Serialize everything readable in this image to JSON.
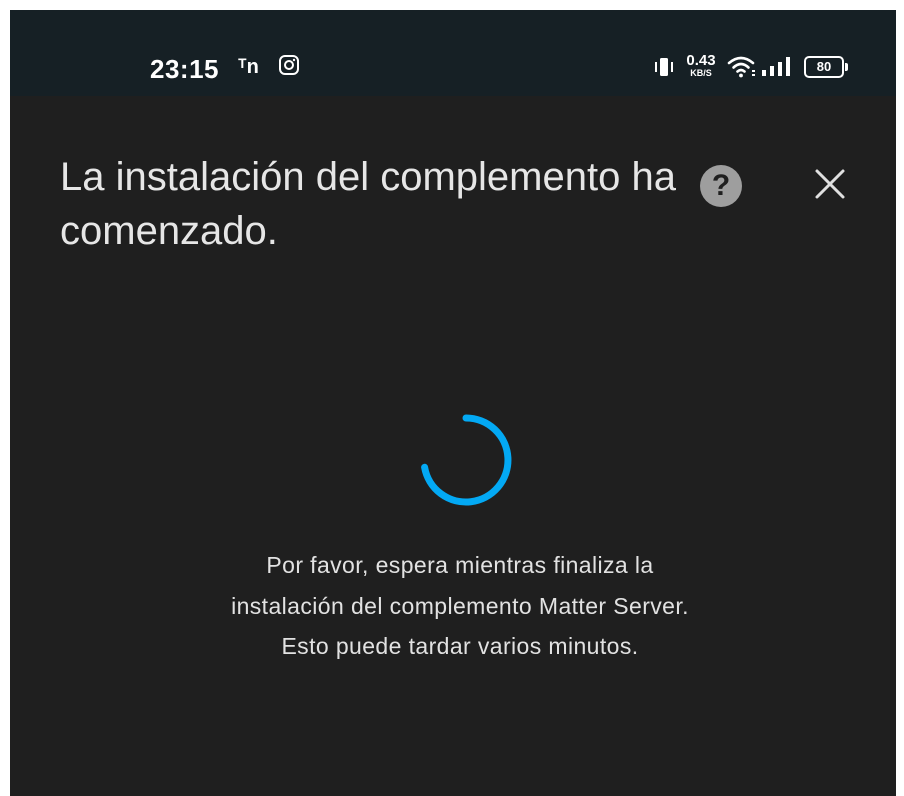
{
  "status_bar": {
    "time": "23:15",
    "app_icons": [
      "tn-icon",
      "instagram-icon"
    ],
    "net_speed_value": "0.43",
    "net_speed_unit": "KB/S",
    "battery_level": "80",
    "status_icons": [
      "vibrate-icon",
      "wifi-icon",
      "signal-icon",
      "battery-icon"
    ]
  },
  "dialog": {
    "title": "La instalación del complemento ha comenzado.",
    "help_icon_glyph": "?",
    "close_icon": "close-icon",
    "message": "Por favor, espera mientras finaliza la instalación del complemento Matter Server. Esto puede tardar varios minutos.",
    "spinner_icon": "loading-spinner"
  },
  "colors": {
    "background": "#1f1f1f",
    "status_bar": "#162025",
    "accent": "#03a9f4",
    "text": "#e6e6e6"
  }
}
